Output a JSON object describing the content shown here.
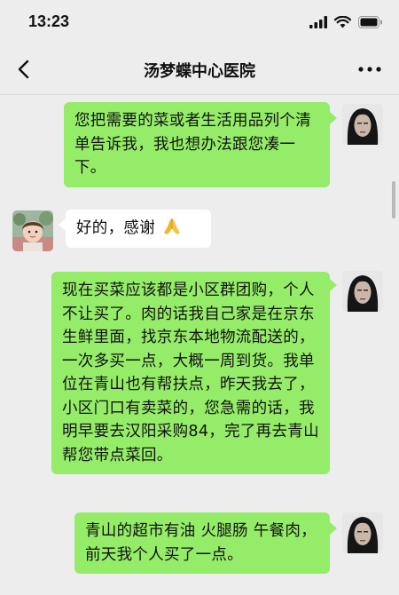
{
  "status_bar": {
    "time": "13:23"
  },
  "header": {
    "title": "汤梦蝶中心医院"
  },
  "messages": [
    {
      "sender": "me",
      "text": "您把需要的菜或者生活用品列个清单告诉我，我也想办法跟您凑一下。"
    },
    {
      "sender": "other",
      "text": "好的，感谢"
    },
    {
      "sender": "me",
      "text": "现在买菜应该都是小区群团购，个人不让买了。肉的话我自己家是在京东生鲜里面，找京东本地物流配送的，一次多买一点，大概一周到货。我单位在青山也有帮扶点，昨天我去了，小区门口有卖菜的，您急需的话，我明早要去汉阳采购84，完了再去青山帮您带点菜回。"
    },
    {
      "sender": "me",
      "text": "青山的超市有油 火腿肠 午餐肉，前天我个人买了一点。"
    }
  ],
  "colors": {
    "background": "#ededed",
    "my_bubble": "#95ec69",
    "their_bubble": "#ffffff"
  }
}
